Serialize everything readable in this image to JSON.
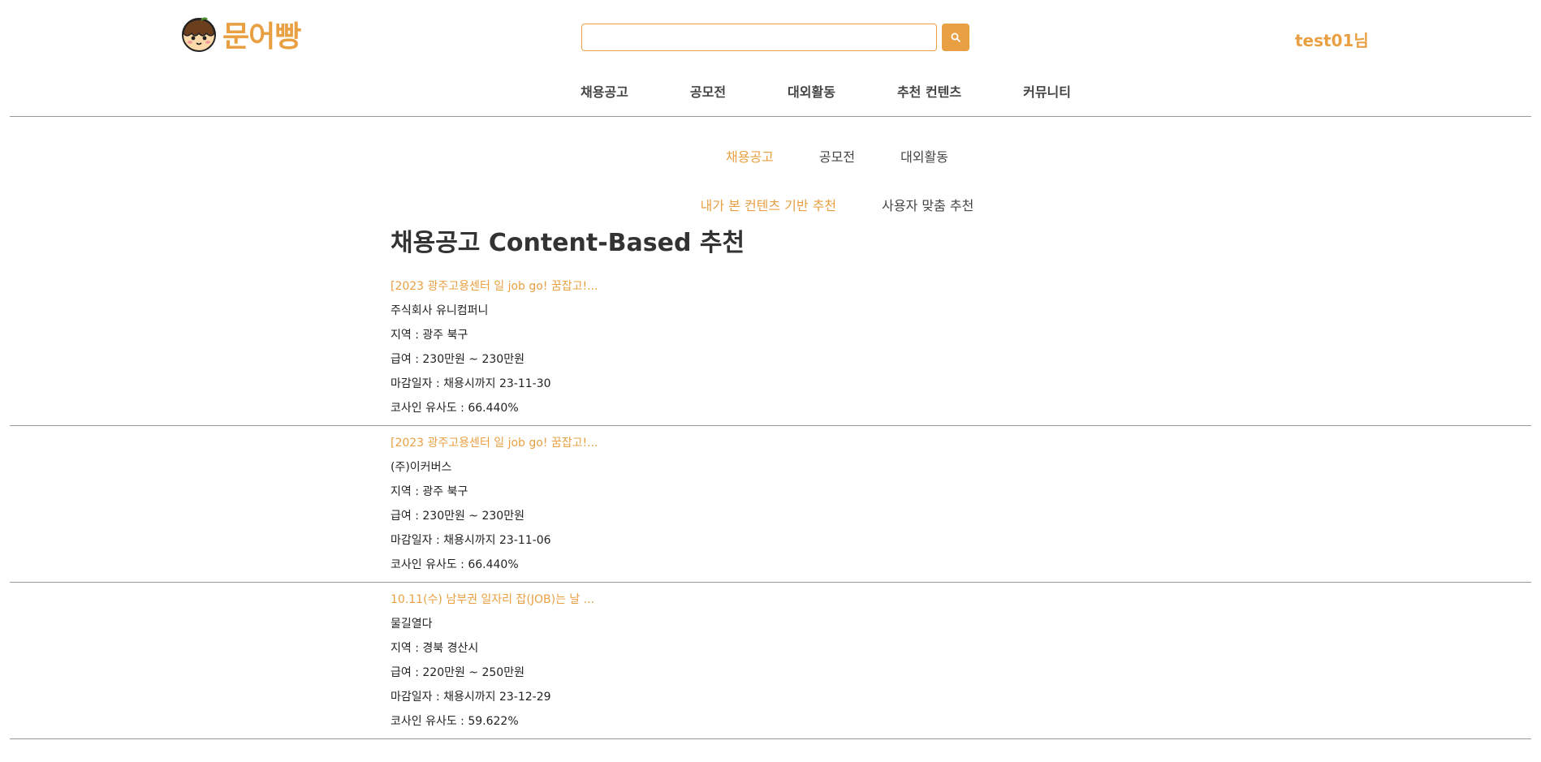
{
  "header": {
    "logo_text": "문어빵",
    "search_placeholder": "",
    "search_icon": "search-icon",
    "user_greeting": "test01님"
  },
  "main_nav": [
    {
      "label": "채용공고"
    },
    {
      "label": "공모전"
    },
    {
      "label": "대외활동"
    },
    {
      "label": "추천 컨텐츠"
    },
    {
      "label": "커뮤니티"
    }
  ],
  "category_tabs": [
    {
      "label": "채용공고",
      "active": true
    },
    {
      "label": "공모전",
      "active": false
    },
    {
      "label": "대외활동",
      "active": false
    }
  ],
  "sub_tabs": [
    {
      "label": "내가 본 컨텐츠 기반 추천",
      "active": true
    },
    {
      "label": "사용자 맞춤 추천",
      "active": false
    }
  ],
  "section_title": "채용공고 Content-Based 추천",
  "jobs": [
    {
      "title": "[2023 광주고용센터 일 job go! 꿈잡고!...",
      "company": "주식회사 유니컴퍼니",
      "region": "지역 : 광주 북구",
      "salary": "급여 : 230만원 ~ 230만원",
      "deadline": "마감일자 : 채용시까지 23-11-30",
      "similarity": "코사인 유사도 : 66.440%"
    },
    {
      "title": "[2023 광주고용센터 일 job go! 꿈잡고!...",
      "company": "(주)이커버스",
      "region": "지역 : 광주 북구",
      "salary": "급여 : 230만원 ~ 230만원",
      "deadline": "마감일자 : 채용시까지 23-11-06",
      "similarity": "코사인 유사도 : 66.440%"
    },
    {
      "title": "10.11(수) 남부권 일자리 잡(JOB)는 날 ...",
      "company": "물길열다",
      "region": "지역 : 경북 경산시",
      "salary": "급여 : 220만원 ~ 250만원",
      "deadline": "마감일자 : 채용시까지 23-12-29",
      "similarity": "코사인 유사도 : 59.622%"
    }
  ],
  "colors": {
    "accent": "#e9a043",
    "text": "#222222",
    "divider": "#999999"
  }
}
